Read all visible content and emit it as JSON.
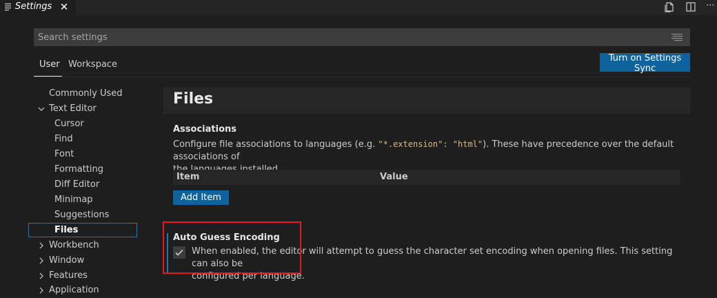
{
  "tab": {
    "title": "Settings",
    "close_glyph": "✕",
    "icon": "preview-list-icon"
  },
  "tab_actions": {
    "icons": [
      "open-settings-json-icon",
      "split-editor-icon",
      "more-actions-icon"
    ],
    "more_glyph": "···"
  },
  "search": {
    "placeholder": "Search settings",
    "value": "",
    "filter_icon": "filter-list-icon"
  },
  "scope_tabs": [
    {
      "label": "User",
      "active": true
    },
    {
      "label": "Workspace",
      "active": false
    }
  ],
  "sync_button": {
    "label": "Turn on Settings Sync"
  },
  "toc": [
    {
      "label": "Commonly Used",
      "chevron": "none"
    },
    {
      "label": "Text Editor",
      "chevron": "down"
    },
    {
      "label": "Cursor",
      "chevron": "none"
    },
    {
      "label": "Find",
      "chevron": "none"
    },
    {
      "label": "Font",
      "chevron": "none"
    },
    {
      "label": "Formatting",
      "chevron": "none"
    },
    {
      "label": "Diff Editor",
      "chevron": "none"
    },
    {
      "label": "Minimap",
      "chevron": "none"
    },
    {
      "label": "Suggestions",
      "chevron": "none"
    },
    {
      "label": "Files",
      "chevron": "none",
      "selected": true
    },
    {
      "label": "Workbench",
      "chevron": "right"
    },
    {
      "label": "Window",
      "chevron": "right"
    },
    {
      "label": "Features",
      "chevron": "right"
    },
    {
      "label": "Application",
      "chevron": "right"
    }
  ],
  "section": {
    "title": "Files"
  },
  "associations": {
    "title": "Associations",
    "desc_part1": "Configure file associations to languages (e.g. ",
    "desc_code1": "\"*.extension\": \"html\"",
    "desc_part2": "). These have precedence over the default associations of",
    "desc_line2": "the languages installed.",
    "columns": [
      "Item",
      "Value"
    ],
    "add_button": "Add Item"
  },
  "auto_guess_encoding": {
    "title": "Auto Guess Encoding",
    "checked": true,
    "desc_line1": "When enabled, the editor will attempt to guess the character set encoding when opening files. This setting can also be",
    "desc_line2": "configured per language."
  },
  "colors": {
    "accent": "#0e639c",
    "focus_border": "#007fd4",
    "annotation_red": "#e5191e",
    "background": "#1e1e1e"
  }
}
